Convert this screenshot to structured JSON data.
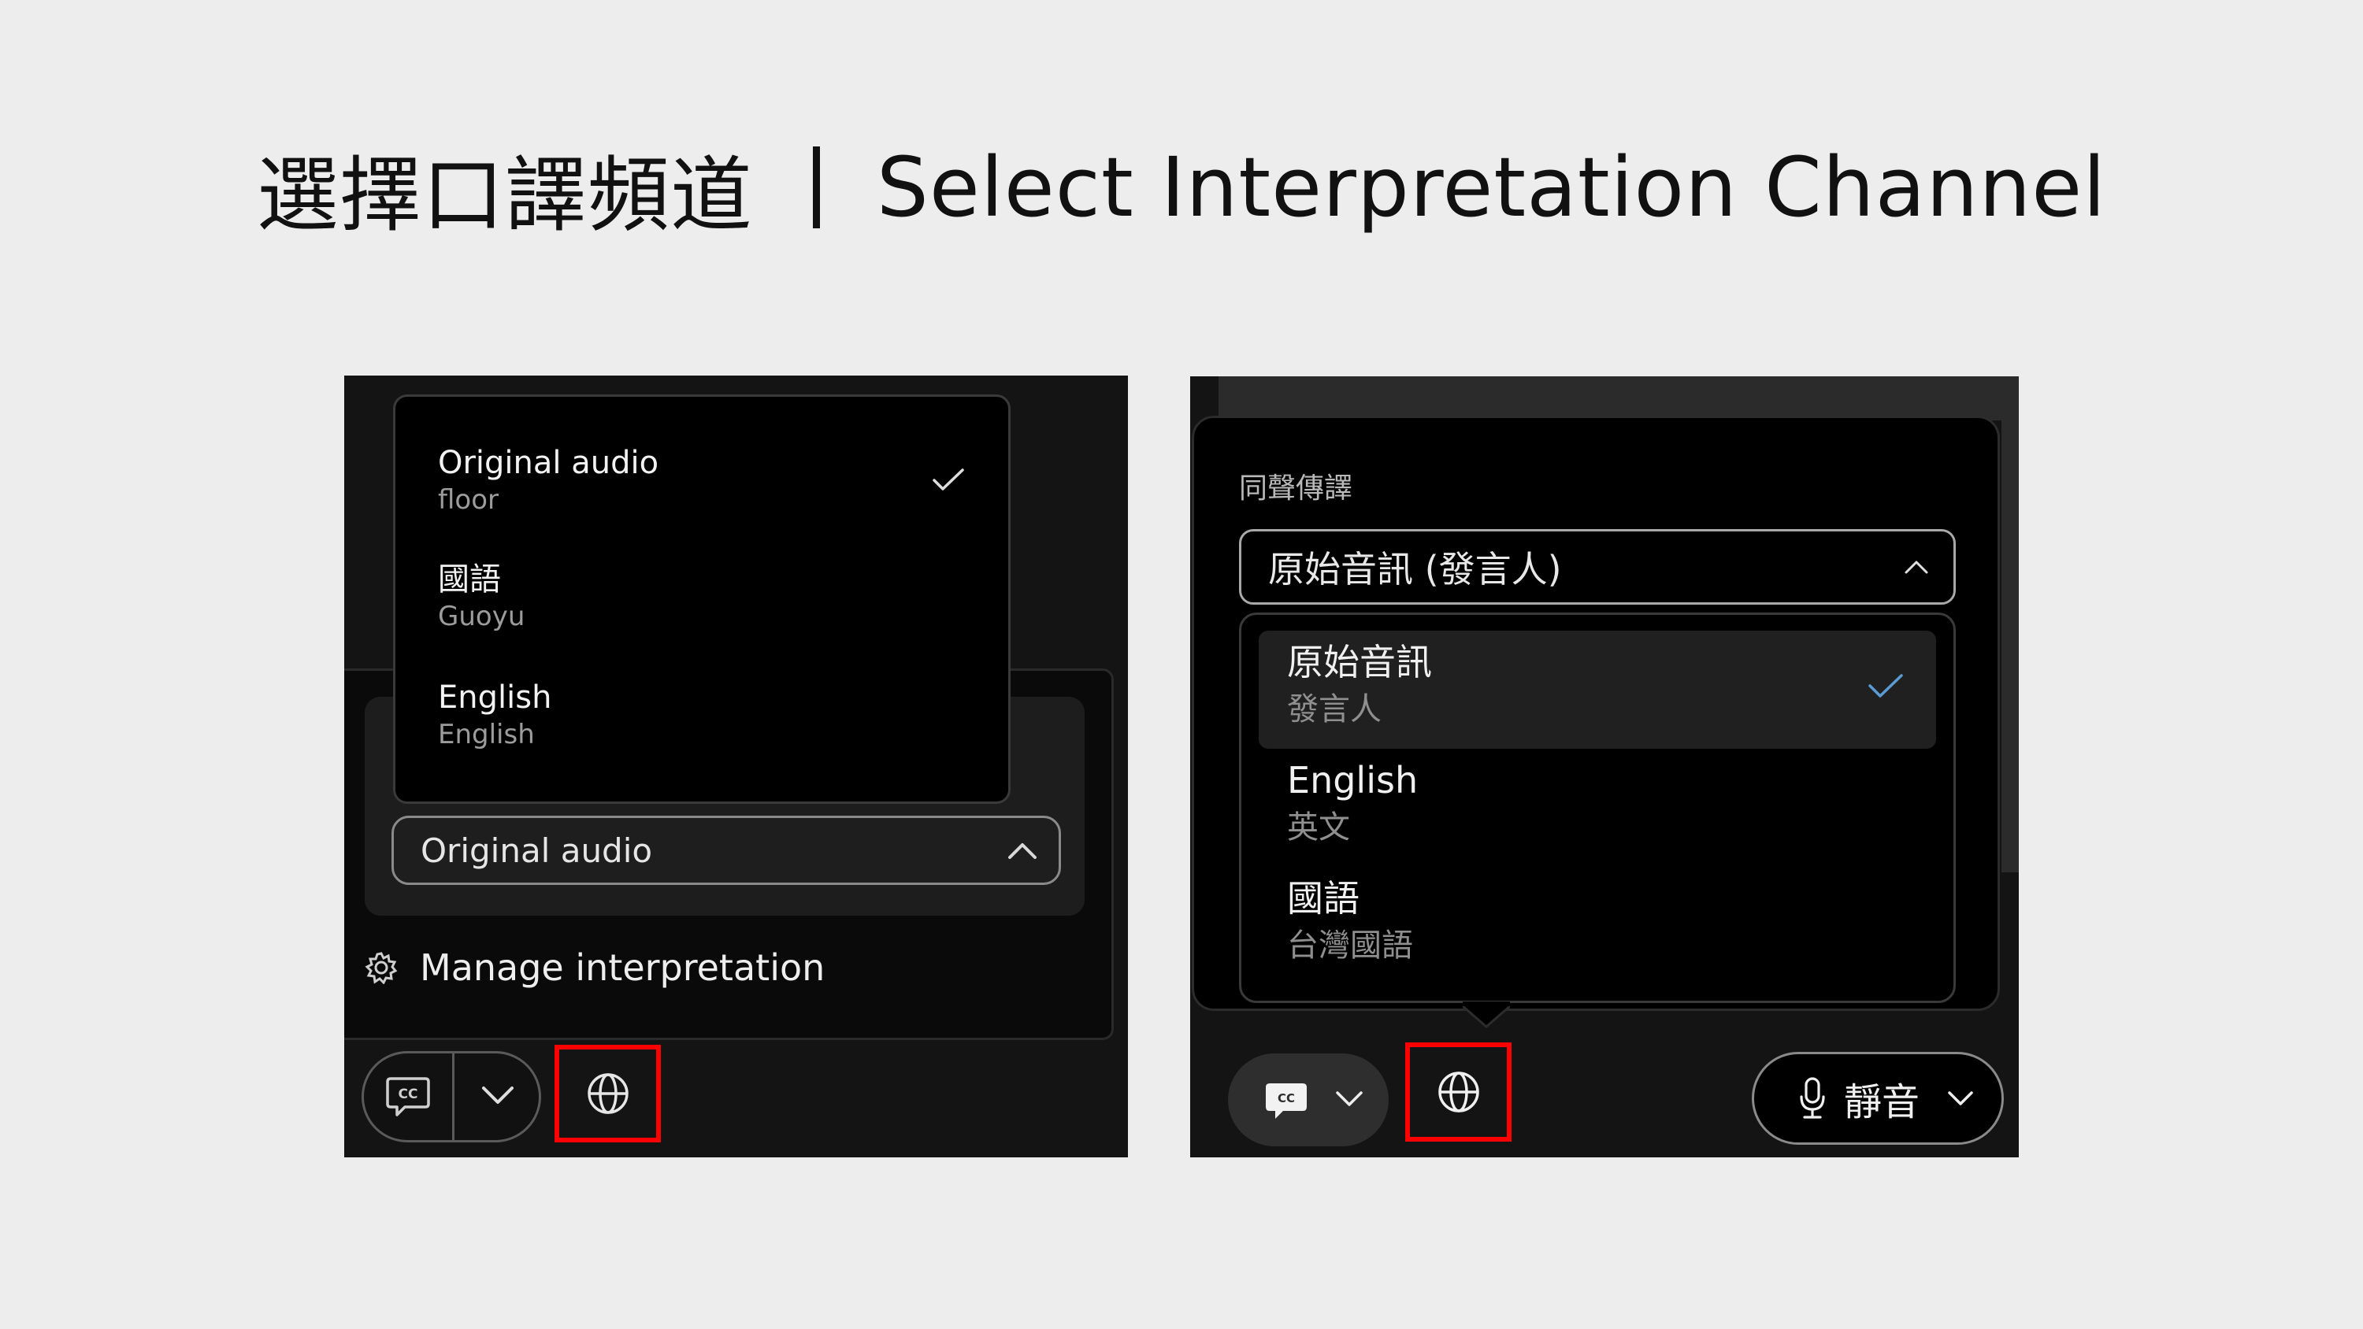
{
  "title": {
    "zh": "選擇口譯頻道",
    "en": "Select Interpretation Channel"
  },
  "left_panel": {
    "menu_items": [
      {
        "primary": "Original audio",
        "secondary": "floor",
        "selected": true
      },
      {
        "primary": "國語",
        "secondary": "Guoyu",
        "selected": false
      },
      {
        "primary": "English",
        "secondary": "English",
        "selected": false
      }
    ],
    "dropdown_value": "Original audio",
    "manage_label": "Manage interpretation",
    "icons": {
      "check": "check-icon",
      "chevron_up": "chevron-up-icon",
      "gear": "gear-icon",
      "cc": "closed-caption-icon",
      "chevron_down": "chevron-down-icon",
      "globe": "globe-icon"
    },
    "highlight_color": "#ff0000"
  },
  "right_panel": {
    "section_label": "同聲傳譯",
    "dropdown_value": "原始音訊 (發言人)",
    "list_items": [
      {
        "primary": "原始音訊",
        "secondary": "發言人",
        "selected": true
      },
      {
        "primary": "English",
        "secondary": "英文",
        "selected": false
      },
      {
        "primary": "國語",
        "secondary": "台灣國語",
        "selected": false
      }
    ],
    "mute_label": "靜音",
    "check_color": "#5b9bd5",
    "highlight_color": "#ff0000"
  }
}
